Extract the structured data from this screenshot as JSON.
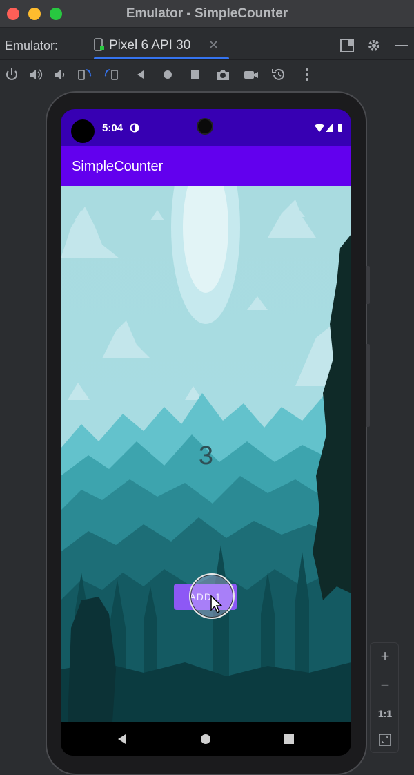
{
  "window": {
    "title": "Emulator - SimpleCounter"
  },
  "tabbar": {
    "label": "Emulator:",
    "device_tab": "Pixel 6 API 30"
  },
  "toolbar": {
    "icons": [
      "power-icon",
      "volume-up-icon",
      "volume-down-icon",
      "rotate-left-icon",
      "rotate-right-icon",
      "back-icon",
      "home-icon",
      "overview-icon",
      "camera-icon",
      "screenrecord-icon",
      "snapshot-icon",
      "more-icon"
    ]
  },
  "device": {
    "status_time": "5:04",
    "app_title": "SimpleCounter",
    "counter_value": "3",
    "add_button_label": "ADD 1"
  },
  "zoom": {
    "zoom_in": "+",
    "zoom_out": "−",
    "ratio": "1:1"
  },
  "colors": {
    "status_bar": "#3700b3",
    "app_bar": "#6200ee",
    "button": "#8d58f5",
    "accent": "#3574f0"
  }
}
